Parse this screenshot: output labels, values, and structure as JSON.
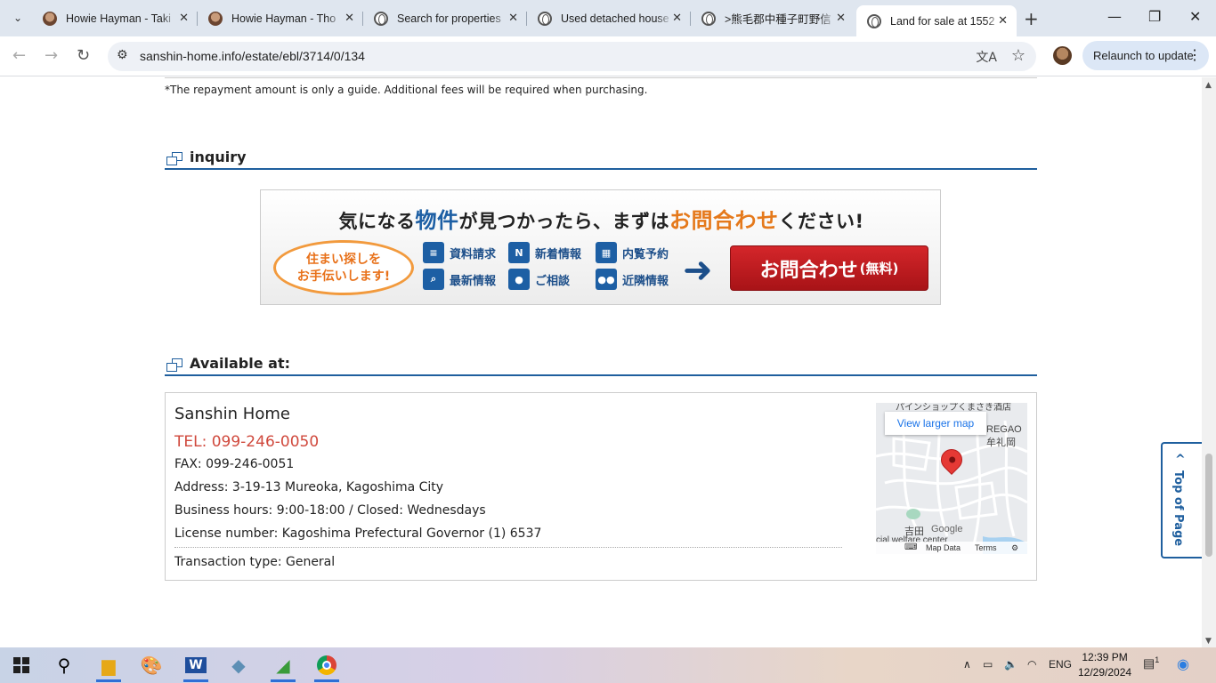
{
  "browser": {
    "tabs": [
      {
        "title": "Howie Hayman - Taki",
        "favicon": "photo-icon"
      },
      {
        "title": "Howie Hayman - Tho",
        "favicon": "photo-icon"
      },
      {
        "title": "Search for properties",
        "favicon": "globe-icon"
      },
      {
        "title": "Used detached house",
        "favicon": "globe-icon"
      },
      {
        "title": ">熊毛郡中種子町野信",
        "favicon": "globe-icon"
      },
      {
        "title": "Land for sale at 1552",
        "favicon": "globe-icon",
        "active": true
      }
    ],
    "url": "sanshin-home.info/estate/ebl/3714/0/134",
    "relaunch_label": "Relaunch to update"
  },
  "page": {
    "note": "*The repayment amount is only a guide. Additional fees will be required when purchasing.",
    "inquiry_heading": "inquiry",
    "banner": {
      "headline_part1": "気になる",
      "headline_part2": "物件",
      "headline_part3": "が見つかったら、まずは",
      "headline_part4": "お問合わせ",
      "headline_part5": "ください!",
      "bubble_line1": "住まい探しを",
      "bubble_line2": "お手伝いします!",
      "items": [
        "資料請求",
        "新着情報",
        "内覧予約",
        "最新情報",
        "ご相談",
        "近隣情報"
      ],
      "button_main": "お問合わせ",
      "button_small": "(無料)"
    },
    "available_heading": "Available at:",
    "shop": {
      "name": "Sanshin Home",
      "tel": "TEL: 099-246-0050",
      "fax": "FAX: 099-246-0051",
      "address": "Address: 3-19-13 Mureoka, Kagoshima City",
      "hours": "Business hours: 9:00-18:00 / Closed: Wednesdays",
      "license": "License number: Kagoshima Prefectural Governor (1) 6537",
      "transaction": "Transaction type: General"
    },
    "map": {
      "larger_label": "View larger map",
      "label_top": "パインショップくまさき酒店",
      "label_regao": "REGAO",
      "label_mureoka": "牟礼岡",
      "label_yoshida": "吉田",
      "label_google": "Google",
      "label_welfare": "cial welfare center",
      "footer_data": "Map Data",
      "footer_terms": "Terms"
    },
    "top_of_page": "Top of Page"
  },
  "taskbar": {
    "language": "ENG",
    "time": "12:39 PM",
    "date": "12/29/2024",
    "notification_count": "1"
  }
}
